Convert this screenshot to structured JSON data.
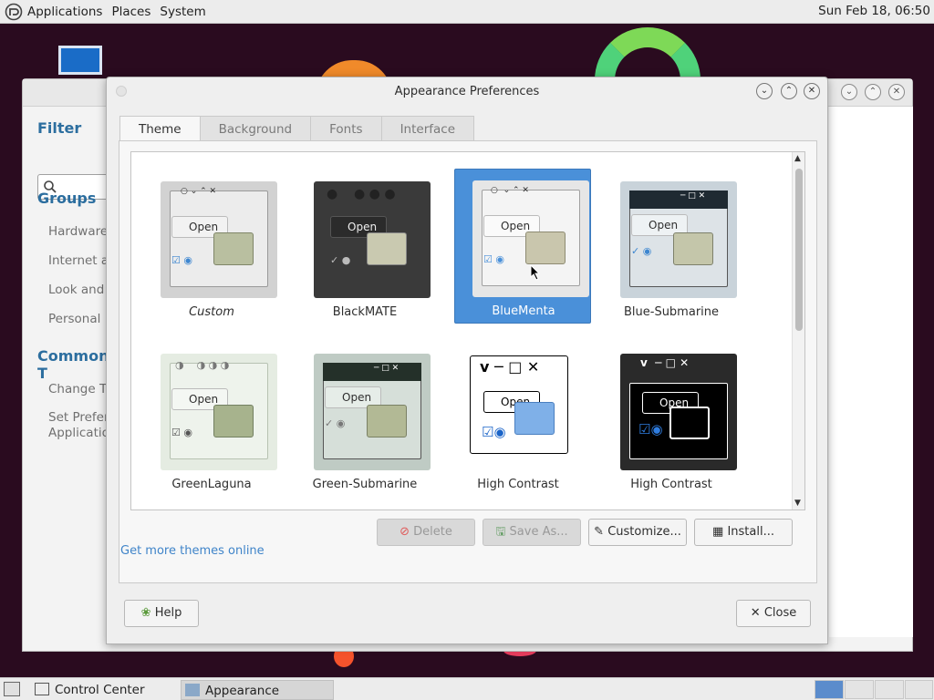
{
  "top_panel": {
    "menus": [
      "Applications",
      "Places",
      "System"
    ],
    "clock": "Sun Feb 18, 06:50"
  },
  "control_center": {
    "filter_heading": "Filter",
    "groups_heading": "Groups",
    "group_items": [
      "Hardware",
      "Internet ar",
      "Look and F",
      "Personal"
    ],
    "common_heading": "Common T",
    "common_items": [
      "Change Th",
      "Set Prefere",
      "Applicatio"
    ]
  },
  "dialog": {
    "title": "Appearance Preferences",
    "tabs": [
      {
        "label": "Theme"
      },
      {
        "label": "Background"
      },
      {
        "label": "Fonts"
      },
      {
        "label": "Interface"
      }
    ],
    "themes": [
      {
        "name": "Custom"
      },
      {
        "name": "BlackMATE"
      },
      {
        "name": "BlueMenta"
      },
      {
        "name": "Blue-Submarine"
      },
      {
        "name": "GreenLaguna"
      },
      {
        "name": "Green-Submarine"
      },
      {
        "name": "High Contrast"
      },
      {
        "name": "High Contrast"
      }
    ],
    "mini_open_label": "Open",
    "actions": {
      "delete": "Delete",
      "save_as": "Save As...",
      "customize": "Customize...",
      "install": "Install..."
    },
    "more_link": "Get more themes online",
    "help": "Help",
    "close": "Close"
  },
  "taskbar": {
    "tasks": [
      "Control Center",
      "Appearance Prefere..."
    ]
  },
  "colors": {
    "accent": "#4a90d9",
    "link": "#3f84c9",
    "heading": "#2c6e9f"
  }
}
